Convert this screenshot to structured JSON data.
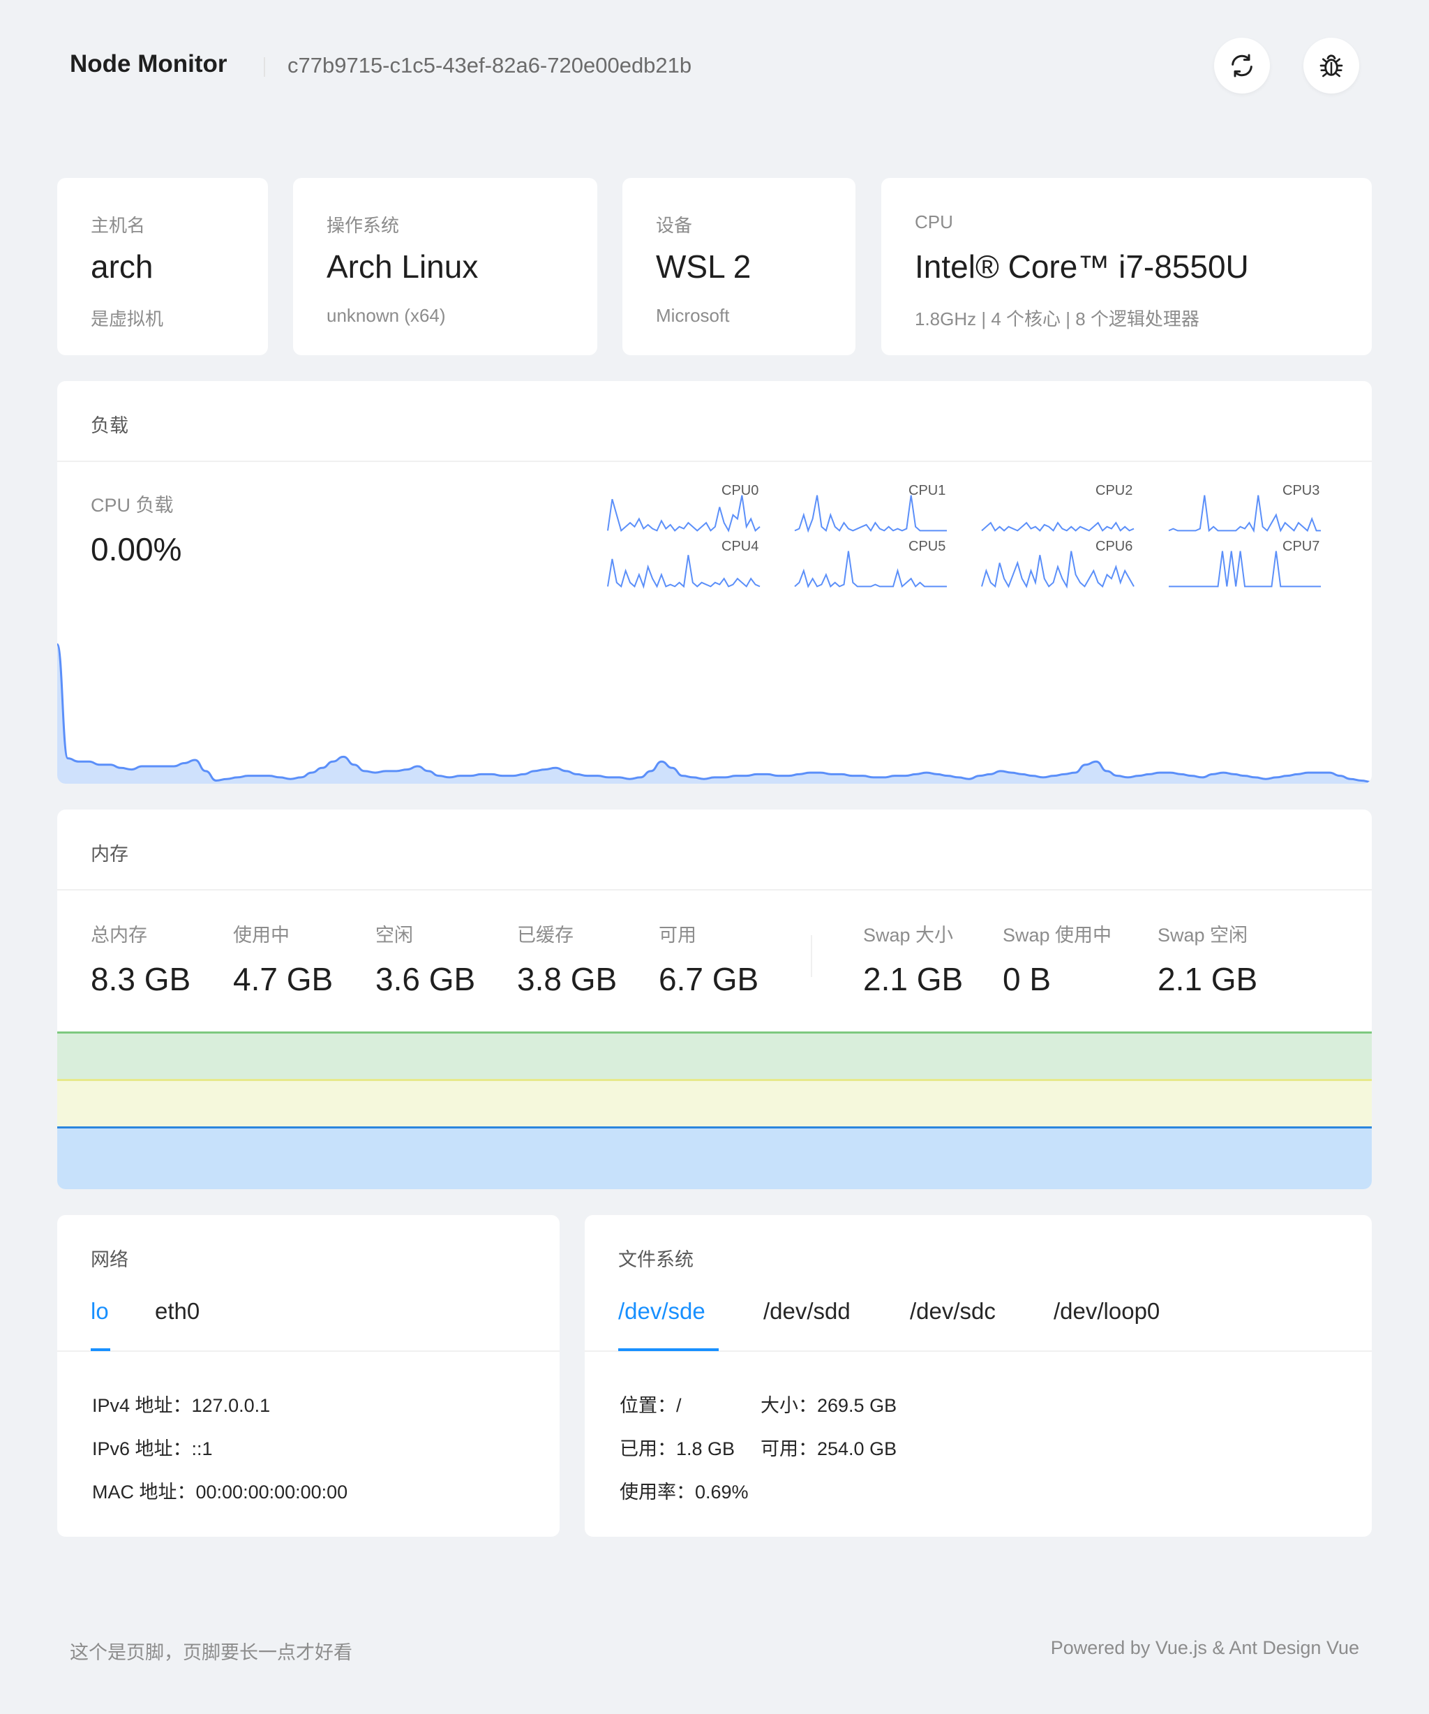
{
  "header": {
    "title": "Node Monitor",
    "node_id": "c77b9715-c1c5-43ef-82a6-720e00edb21b",
    "refresh_icon": "refresh-icon",
    "debug_icon": "bug-icon"
  },
  "info": {
    "hostname": {
      "label": "主机名",
      "value": "arch",
      "sub": "是虚拟机"
    },
    "os": {
      "label": "操作系统",
      "value": "Arch Linux",
      "sub": "unknown (x64)"
    },
    "device": {
      "label": "设备",
      "value": "WSL 2",
      "sub": "Microsoft"
    },
    "cpu": {
      "label": "CPU",
      "value": "Intel® Core™ i7-8550U",
      "sub": "1.8GHz | 4 个核心 | 8 个逻辑处理器"
    }
  },
  "load": {
    "title": "负载",
    "cpu_load_label": "CPU 负载",
    "cpu_load_value": "0.00%",
    "cores": [
      "CPU0",
      "CPU1",
      "CPU2",
      "CPU3",
      "CPU4",
      "CPU5",
      "CPU6",
      "CPU7"
    ],
    "chart_data": {
      "type": "area",
      "series": [
        {
          "values": [
            88,
            16,
            14,
            14,
            12,
            12,
            10,
            9,
            11,
            11,
            11,
            11,
            13,
            15,
            8,
            2,
            3,
            4,
            5,
            5,
            5,
            4,
            3,
            4,
            7,
            10,
            14,
            17,
            12,
            8,
            7,
            8,
            8,
            9,
            11,
            8,
            5,
            4,
            5,
            5,
            6,
            6,
            5,
            5,
            6,
            8,
            9,
            10,
            8,
            6,
            5,
            5,
            4,
            4,
            3,
            4,
            8,
            14,
            10,
            5,
            4,
            3,
            4,
            4,
            5,
            5,
            6,
            6,
            5,
            5,
            6,
            7,
            7,
            6,
            6,
            5,
            5,
            4,
            4,
            5,
            5,
            6,
            7,
            6,
            5,
            4,
            3,
            5,
            6,
            8,
            7,
            6,
            5,
            4,
            5,
            6,
            7,
            12,
            14,
            8,
            5,
            4,
            5,
            6,
            7,
            7,
            6,
            5,
            4,
            6,
            7,
            6,
            5,
            4,
            3,
            4,
            5,
            6,
            7,
            7,
            7,
            5,
            3,
            2,
            1
          ]
        }
      ]
    },
    "core_series": [
      [
        2,
        18,
        10,
        2,
        4,
        6,
        4,
        8,
        3,
        5,
        3,
        2,
        7,
        3,
        5,
        2,
        4,
        3,
        6,
        4,
        2,
        4,
        6,
        2,
        4,
        14,
        6,
        2,
        10,
        8,
        20,
        4,
        8,
        2,
        4
      ],
      [
        2,
        3,
        10,
        2,
        8,
        20,
        4,
        2,
        10,
        4,
        2,
        6,
        3,
        2,
        3,
        4,
        5,
        2,
        6,
        3,
        2,
        4,
        2,
        3,
        2,
        3,
        20,
        4,
        2,
        2,
        2,
        2,
        2,
        2,
        2
      ],
      [
        2,
        4,
        6,
        2,
        4,
        2,
        4,
        3,
        2,
        4,
        6,
        3,
        4,
        2,
        5,
        4,
        2,
        6,
        3,
        2,
        4,
        2,
        4,
        3,
        2,
        4,
        6,
        2,
        4,
        3,
        6,
        2,
        4,
        2,
        3
      ],
      [
        2,
        3,
        2,
        2,
        2,
        2,
        2,
        3,
        20,
        2,
        4,
        2,
        2,
        2,
        2,
        2,
        4,
        3,
        6,
        2,
        20,
        4,
        2,
        6,
        10,
        2,
        6,
        4,
        2,
        6,
        4,
        2,
        8,
        2,
        2
      ],
      [
        2,
        16,
        4,
        2,
        10,
        4,
        2,
        8,
        2,
        12,
        6,
        2,
        8,
        2,
        3,
        2,
        4,
        2,
        18,
        4,
        2,
        4,
        3,
        2,
        4,
        3,
        6,
        2,
        3,
        6,
        4,
        2,
        6,
        3,
        2
      ],
      [
        2,
        4,
        10,
        2,
        6,
        2,
        3,
        8,
        2,
        4,
        2,
        3,
        20,
        4,
        2,
        2,
        2,
        2,
        3,
        2,
        2,
        2,
        2,
        10,
        2,
        4,
        6,
        2,
        4,
        2,
        2,
        2,
        2,
        2,
        2
      ],
      [
        2,
        10,
        4,
        2,
        14,
        6,
        2,
        8,
        14,
        6,
        2,
        10,
        4,
        18,
        6,
        2,
        4,
        12,
        6,
        2,
        20,
        8,
        4,
        2,
        6,
        10,
        4,
        2,
        8,
        6,
        12,
        4,
        10,
        6,
        2
      ],
      [
        2,
        2,
        2,
        2,
        2,
        2,
        2,
        2,
        2,
        2,
        2,
        2,
        20,
        2,
        20,
        2,
        20,
        2,
        2,
        2,
        2,
        2,
        2,
        2,
        20,
        2,
        2,
        2,
        2,
        2,
        2,
        2,
        2,
        2,
        2
      ]
    ],
    "colors": {
      "line": "#5b8ff9",
      "fill": "#c7dcfc"
    }
  },
  "memory": {
    "title": "内存",
    "stats": [
      {
        "label": "总内存",
        "value": "8.3 GB"
      },
      {
        "label": "使用中",
        "value": "4.7 GB"
      },
      {
        "label": "空闲",
        "value": "3.6 GB"
      },
      {
        "label": "已缓存",
        "value": "3.8 GB"
      },
      {
        "label": "可用",
        "value": "6.7 GB"
      }
    ],
    "swap": [
      {
        "label": "Swap 大小",
        "value": "2.1 GB"
      },
      {
        "label": "Swap 使用中",
        "value": "0 B"
      },
      {
        "label": "Swap 空闲",
        "value": "2.1 GB"
      }
    ],
    "colors": {
      "green": "#7dc97f",
      "yellow": "#e7e98a",
      "blue": "#2b86dd"
    }
  },
  "network": {
    "title": "网络",
    "tabs": [
      "lo",
      "eth0"
    ],
    "active_tab": "lo",
    "ipv4": "IPv4 地址：127.0.0.1",
    "ipv6": "IPv6 地址：::1",
    "mac": "MAC 地址：00:00:00:00:00:00"
  },
  "filesystem": {
    "title": "文件系统",
    "tabs": [
      "/dev/sde",
      "/dev/sdd",
      "/dev/sdc",
      "/dev/loop0"
    ],
    "active_tab": "/dev/sde",
    "location": "位置：/",
    "size": "大小：269.5 GB",
    "used": "已用：1.8 GB",
    "available": "可用：254.0 GB",
    "usage": "使用率：0.69%"
  },
  "footer": {
    "left": "这个是页脚，页脚要长一点才好看",
    "right": "Powered by Vue.js & Ant Design Vue"
  }
}
